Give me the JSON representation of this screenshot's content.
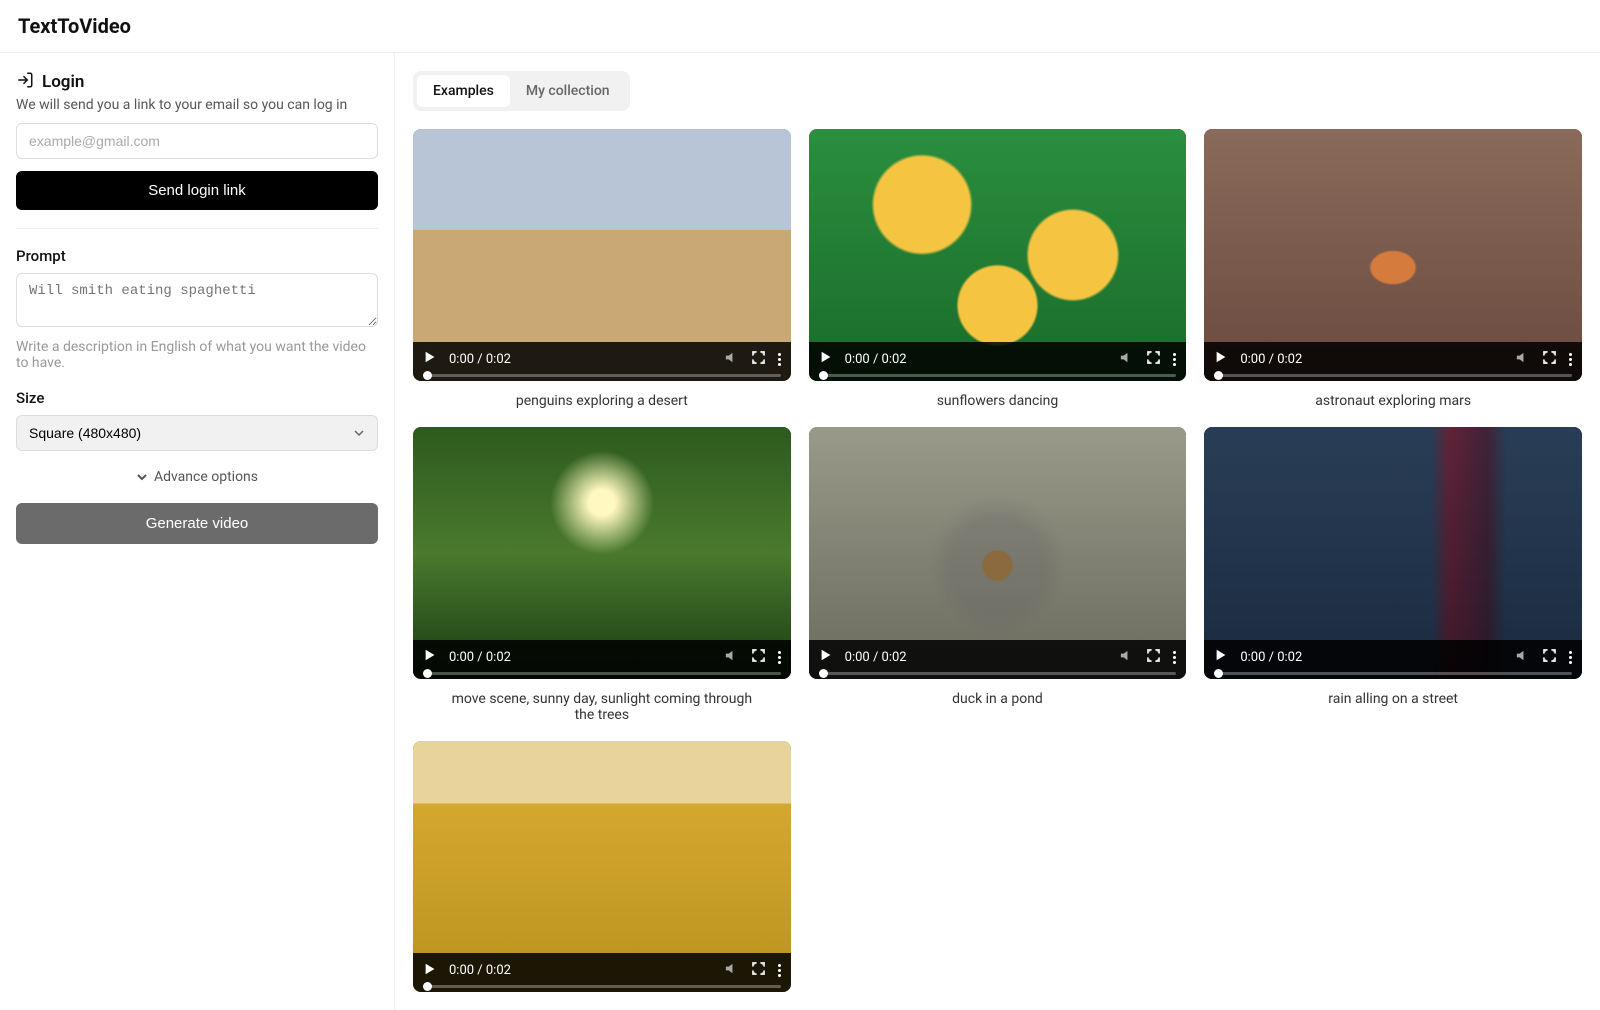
{
  "app": {
    "title": "TextToVideo"
  },
  "login": {
    "title": "Login",
    "description": "We will send you a link to your email so you can log in",
    "email_placeholder": "example@gmail.com",
    "button": "Send login link"
  },
  "prompt": {
    "label": "Prompt",
    "placeholder": "Will smith eating spaghetti",
    "hint": "Write a description in English of what you want the video to have."
  },
  "size": {
    "label": "Size",
    "selected": "Square (480x480)"
  },
  "advance": {
    "label": "Advance options"
  },
  "generate": {
    "label": "Generate video"
  },
  "tabs": [
    {
      "label": "Examples",
      "active": true
    },
    {
      "label": "My collection",
      "active": false
    }
  ],
  "video_time": "0:00 / 0:02",
  "examples": [
    {
      "caption": "penguins exploring a desert",
      "bg": "bg-desert"
    },
    {
      "caption": "sunflowers dancing",
      "bg": "bg-sunflowers"
    },
    {
      "caption": "astronaut exploring mars",
      "bg": "bg-mars"
    },
    {
      "caption": "move scene, sunny day, sunlight coming through the trees",
      "bg": "bg-trees"
    },
    {
      "caption": "duck in a pond",
      "bg": "bg-pond"
    },
    {
      "caption": "rain alling on a street",
      "bg": "bg-rain"
    },
    {
      "caption": "",
      "bg": "bg-field"
    }
  ]
}
